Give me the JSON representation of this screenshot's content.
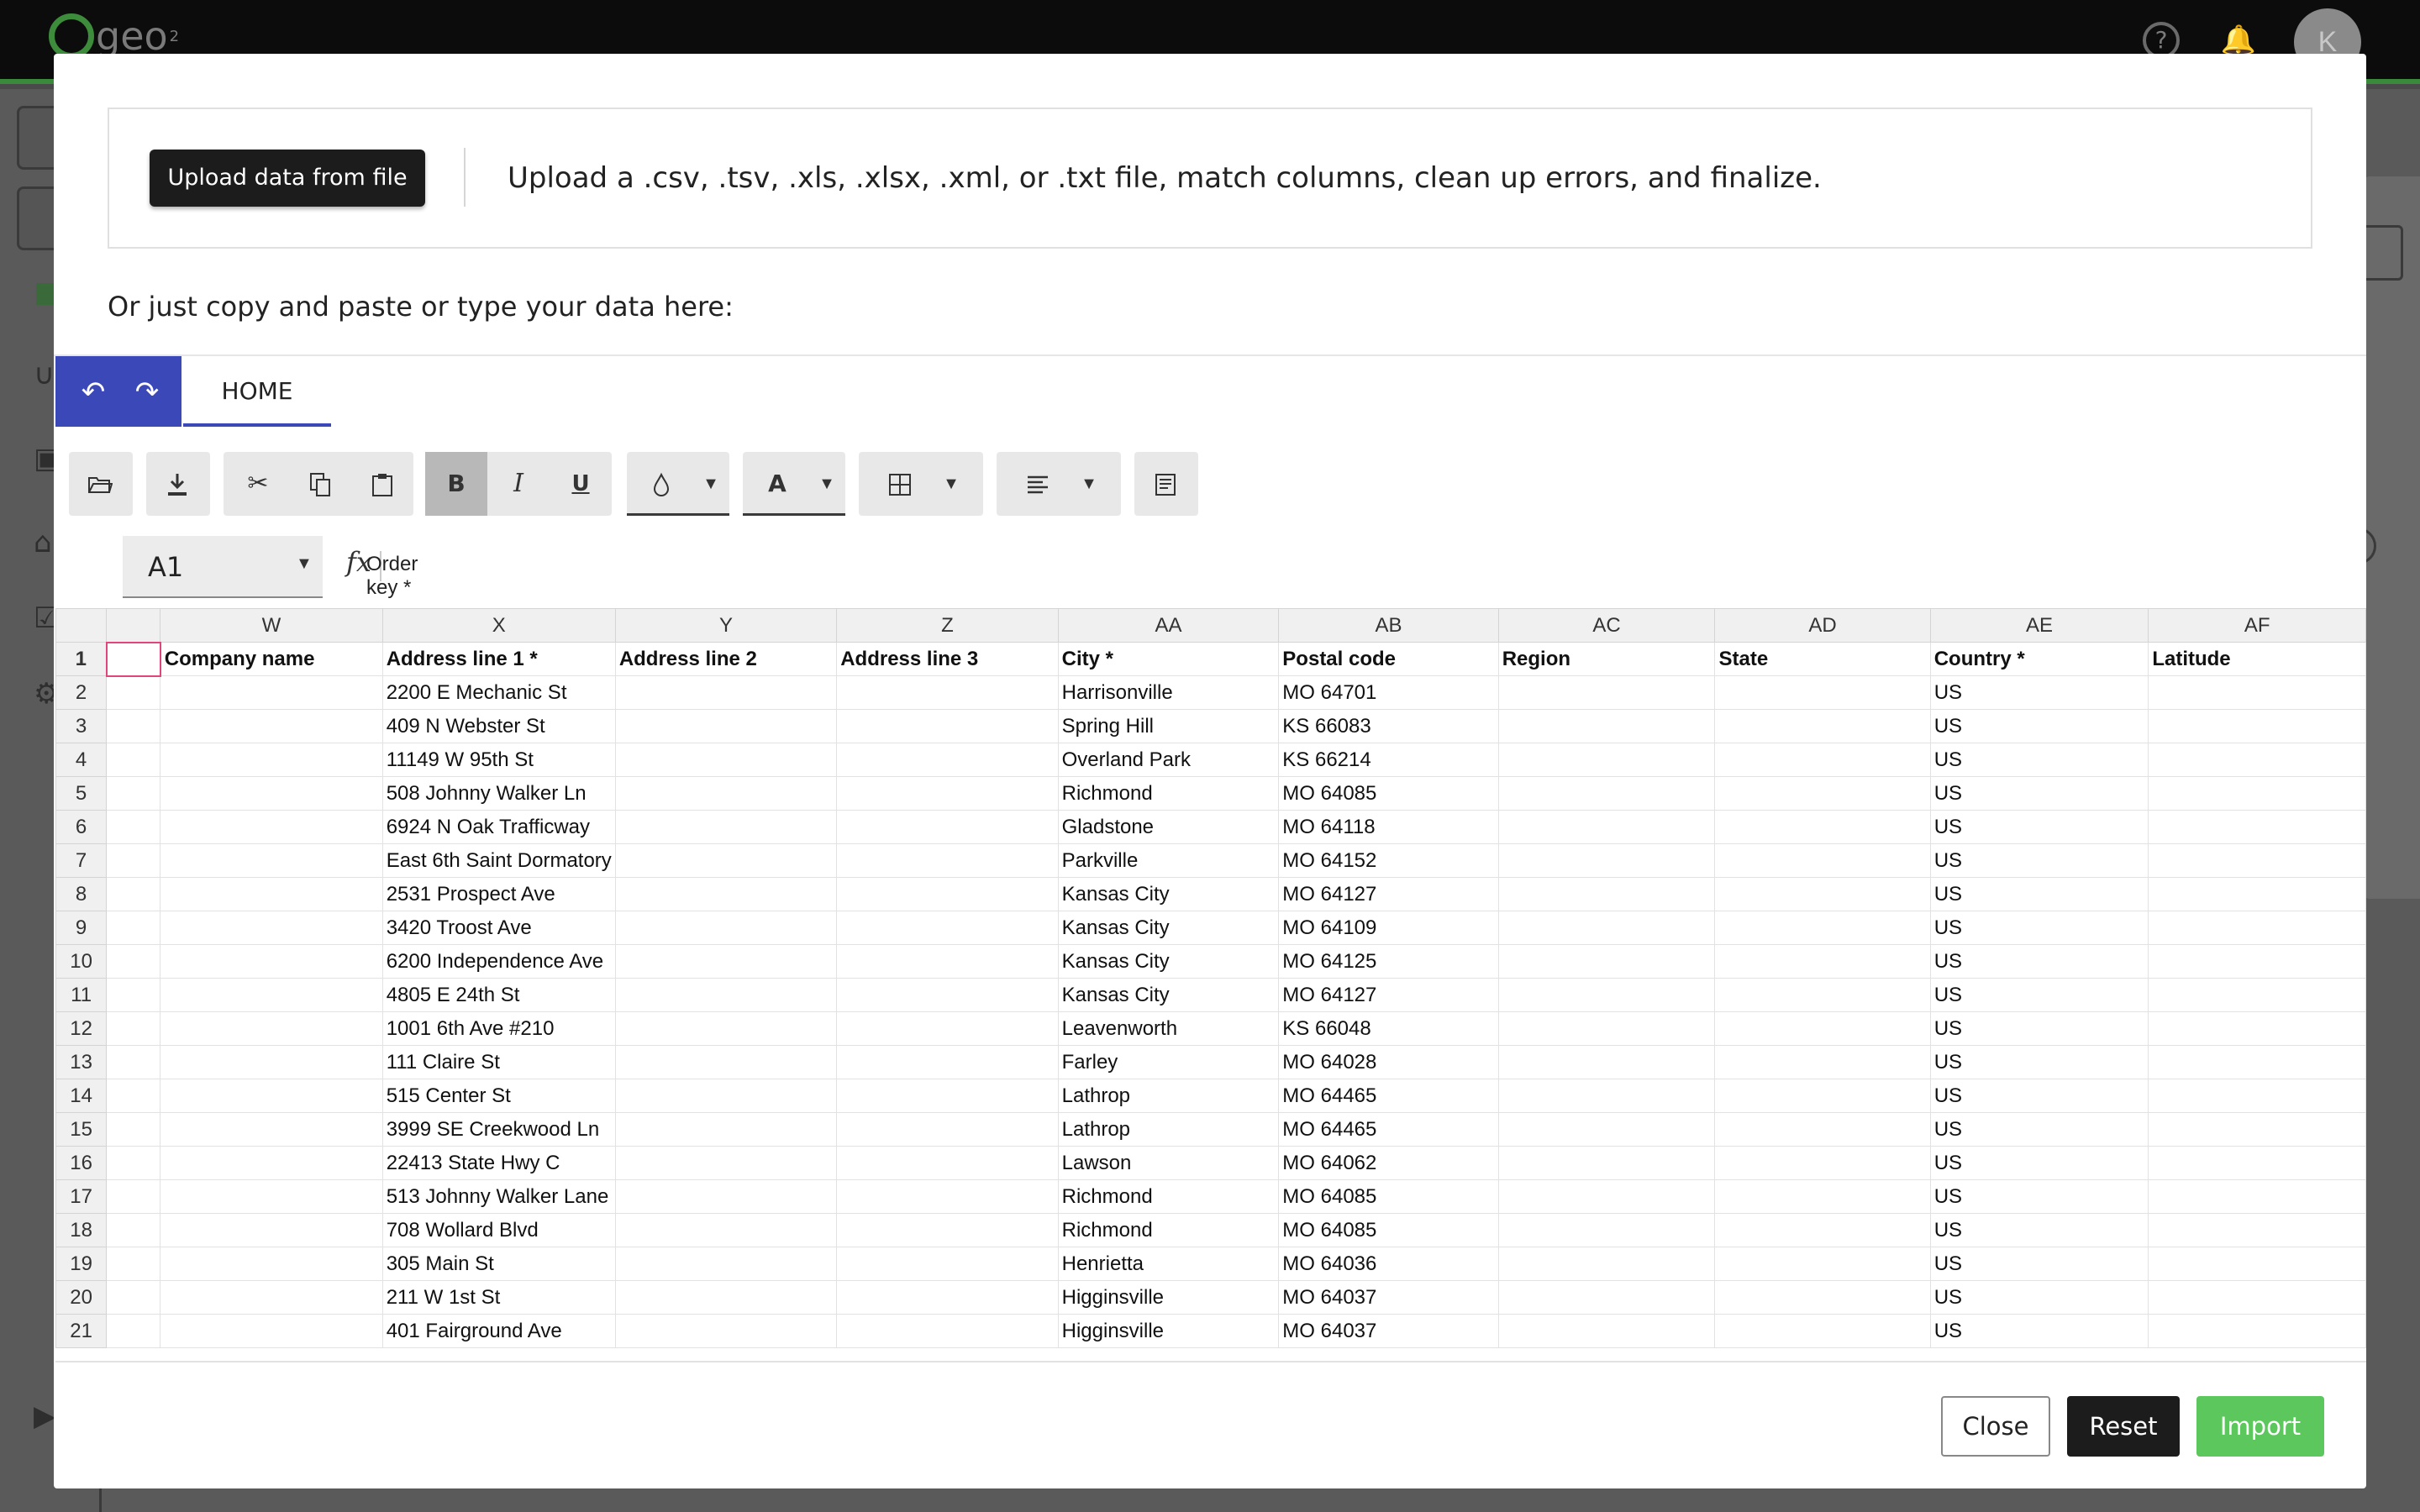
{
  "app": {
    "logo_text": "geo",
    "logo_sub": "2",
    "avatar_initial": "K"
  },
  "modal": {
    "upload_button_label": "Upload data from file",
    "upload_description": "Upload a .csv, .tsv, .xls, .xlsx, .xml, or .txt file, match columns, clean up errors, and finalize.",
    "paste_prompt": "Or just copy and paste or type your data here:",
    "ribbon_tab": "HOME",
    "toolbar": {
      "bold_label": "B",
      "italic_label": "I",
      "underline_label": "U",
      "font_color_label": "A",
      "icons": [
        "open-folder-icon",
        "download-icon",
        "cut-icon",
        "copy-icon",
        "paste-icon",
        "fill-color-icon",
        "borders-icon",
        "align-icon",
        "wrap-text-icon"
      ]
    },
    "formula_bar": {
      "cell_ref": "A1",
      "fx_label": "fx",
      "value": "Order key *"
    },
    "footer": {
      "close_label": "Close",
      "reset_label": "Reset",
      "import_label": "Import"
    }
  },
  "sheet": {
    "columns": [
      "W",
      "X",
      "Y",
      "Z",
      "AA",
      "AB",
      "AC",
      "AD",
      "AE",
      "AF"
    ],
    "header_row": {
      "num": "1",
      "cells": [
        "Company name",
        "Address line 1 *",
        "Address line 2",
        "Address line 3",
        "City *",
        "Postal code",
        "Region",
        "State",
        "Country *",
        "Latitude"
      ]
    },
    "rows": [
      {
        "num": "2",
        "cells": [
          "",
          "2200 E Mechanic St",
          "",
          "",
          "Harrisonville",
          "MO 64701",
          "",
          "",
          "US",
          ""
        ]
      },
      {
        "num": "3",
        "cells": [
          "",
          "409 N Webster St",
          "",
          "",
          "Spring Hill",
          "KS 66083",
          "",
          "",
          "US",
          ""
        ]
      },
      {
        "num": "4",
        "cells": [
          "",
          "11149 W 95th St",
          "",
          "",
          "Overland Park",
          "KS 66214",
          "",
          "",
          "US",
          ""
        ]
      },
      {
        "num": "5",
        "cells": [
          "",
          "508 Johnny Walker Ln",
          "",
          "",
          "Richmond",
          "MO 64085",
          "",
          "",
          "US",
          ""
        ]
      },
      {
        "num": "6",
        "cells": [
          "",
          "6924 N Oak Trafficway",
          "",
          "",
          "Gladstone",
          "MO 64118",
          "",
          "",
          "US",
          ""
        ]
      },
      {
        "num": "7",
        "cells": [
          "",
          "East 6th Saint Dormatory",
          "",
          "",
          "Parkville",
          "MO 64152",
          "",
          "",
          "US",
          ""
        ]
      },
      {
        "num": "8",
        "cells": [
          "",
          "2531 Prospect Ave",
          "",
          "",
          "Kansas City",
          "MO 64127",
          "",
          "",
          "US",
          ""
        ]
      },
      {
        "num": "9",
        "cells": [
          "",
          "3420 Troost Ave",
          "",
          "",
          "Kansas City",
          "MO 64109",
          "",
          "",
          "US",
          ""
        ]
      },
      {
        "num": "10",
        "cells": [
          "",
          "6200 Independence Ave",
          "",
          "",
          "Kansas City",
          "MO 64125",
          "",
          "",
          "US",
          ""
        ]
      },
      {
        "num": "11",
        "cells": [
          "",
          "4805 E 24th St",
          "",
          "",
          "Kansas City",
          "MO 64127",
          "",
          "",
          "US",
          ""
        ]
      },
      {
        "num": "12",
        "cells": [
          "",
          "1001 6th Ave #210",
          "",
          "",
          "Leavenworth",
          "KS 66048",
          "",
          "",
          "US",
          ""
        ]
      },
      {
        "num": "13",
        "cells": [
          "",
          "111 Claire St",
          "",
          "",
          "Farley",
          "MO 64028",
          "",
          "",
          "US",
          ""
        ]
      },
      {
        "num": "14",
        "cells": [
          "",
          "515 Center St",
          "",
          "",
          "Lathrop",
          "MO 64465",
          "",
          "",
          "US",
          ""
        ]
      },
      {
        "num": "15",
        "cells": [
          "",
          "3999 SE Creekwood Ln",
          "",
          "",
          "Lathrop",
          "MO 64465",
          "",
          "",
          "US",
          ""
        ]
      },
      {
        "num": "16",
        "cells": [
          "",
          "22413 State Hwy C",
          "",
          "",
          "Lawson",
          "MO 64062",
          "",
          "",
          "US",
          ""
        ]
      },
      {
        "num": "17",
        "cells": [
          "",
          "513 Johnny Walker Lane",
          "",
          "",
          "Richmond",
          "MO 64085",
          "",
          "",
          "US",
          ""
        ]
      },
      {
        "num": "18",
        "cells": [
          "",
          "708 Wollard Blvd",
          "",
          "",
          "Richmond",
          "MO 64085",
          "",
          "",
          "US",
          ""
        ]
      },
      {
        "num": "19",
        "cells": [
          "",
          "305 Main St",
          "",
          "",
          "Henrietta",
          "MO 64036",
          "",
          "",
          "US",
          ""
        ]
      },
      {
        "num": "20",
        "cells": [
          "",
          "211 W 1st St",
          "",
          "",
          "Higginsville",
          "MO 64037",
          "",
          "",
          "US",
          ""
        ]
      },
      {
        "num": "21",
        "cells": [
          "",
          "401 Fairground Ave",
          "",
          "",
          "Higginsville",
          "MO 64037",
          "",
          "",
          "US",
          ""
        ]
      }
    ]
  },
  "colors": {
    "ribbon_accent": "#3a48b8",
    "import_button": "#5cc75c",
    "dark_button": "#1c1c1c",
    "selection_border": "#e0457b",
    "app_accent": "#3b8a3b"
  }
}
